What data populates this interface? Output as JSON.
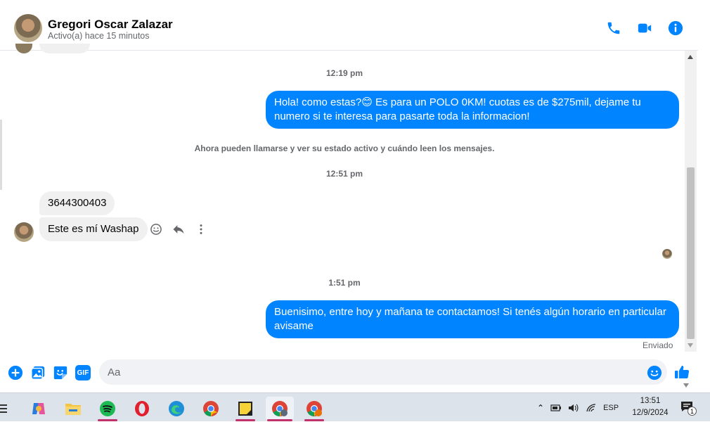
{
  "header": {
    "contact_name": "Gregori Oscar Zalazar",
    "status": "Activo(a) hace 15 minutos",
    "icons": [
      "phone-icon",
      "video-camera-icon",
      "info-icon"
    ],
    "accent_color": "#0084ff"
  },
  "messages": {
    "time_1": "12:19 pm",
    "out_1": "Hola! como estas?😊 Es para un POLO 0KM! cuotas es de $275mil, dejame tu numero si te interesa para pasarte toda la informacion!",
    "system_note": "Ahora pueden llamarse y ver su estado activo y cuándo leen los mensajes.",
    "time_2": "12:51 pm",
    "in_1": "3644300403",
    "in_2": "Este es mí Washap",
    "time_3": "1:51 pm",
    "out_2": "Buenisimo, entre hoy y mañana te contactamos! Si tenés algún horario en particular avisame",
    "delivery_status": "Enviado"
  },
  "composer": {
    "placeholder": "Aa",
    "icons": [
      "plus-circle-icon",
      "image-icon",
      "sticker-icon",
      "gif-icon",
      "emoji-icon",
      "thumbs-up-icon"
    ],
    "gif_label": "GIF"
  },
  "taskbar": {
    "apps": [
      "copilot-icon",
      "file-explorer-icon",
      "spotify-icon",
      "opera-icon",
      "edge-icon",
      "chrome-icon",
      "sticky-notes-icon",
      "chrome-profile-1-icon",
      "chrome-profile-2-icon"
    ],
    "language": "ESP",
    "time": "13:51",
    "date": "12/9/2024",
    "notification_count": "1"
  }
}
